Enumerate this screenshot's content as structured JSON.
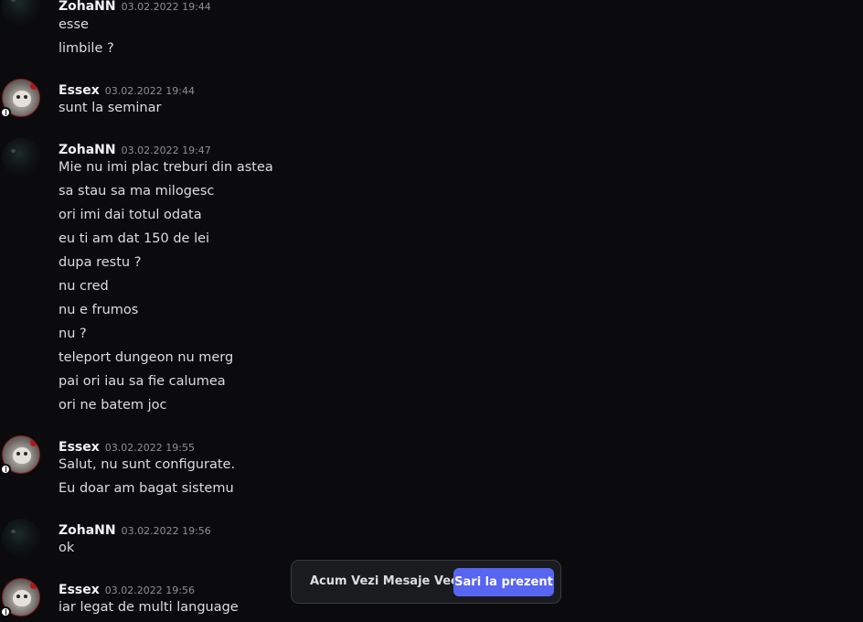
{
  "colors": {
    "background": "#0b0b0d",
    "username": "#f2f3f5",
    "timestamp": "#8c8f96",
    "message_text": "#dcdde1",
    "jump_button": "#5865f2",
    "jump_bar_background": "#1a1b1e"
  },
  "messages": [
    {
      "author": "ZohaNN",
      "timestamp": "03.02.2022 19:44",
      "avatar": "dark-avatar",
      "lines": [
        "esse",
        "limbile ?"
      ]
    },
    {
      "author": "Essex",
      "timestamp": "03.02.2022 19:44",
      "avatar": "grumpy-cat-avatar",
      "lines": [
        "sunt la seminar"
      ]
    },
    {
      "author": "ZohaNN",
      "timestamp": "03.02.2022 19:47",
      "avatar": "dark-avatar",
      "lines": [
        "Mie nu imi plac treburi din astea",
        "sa stau sa ma milogesc",
        "ori imi dai totul odata",
        "eu ti am dat 150 de lei",
        "dupa restu ?",
        "nu cred",
        "nu e frumos",
        "nu ?",
        "teleport dungeon nu merg",
        "pai ori iau sa fie calumea",
        "ori ne batem joc"
      ]
    },
    {
      "author": "Essex",
      "timestamp": "03.02.2022 19:55",
      "avatar": "grumpy-cat-avatar",
      "lines": [
        "Salut, nu sunt configurate.",
        "Eu doar am bagat sistemu"
      ]
    },
    {
      "author": "ZohaNN",
      "timestamp": "03.02.2022 19:56",
      "avatar": "dark-avatar",
      "lines": [
        "ok"
      ]
    },
    {
      "author": "Essex",
      "timestamp": "03.02.2022 19:56",
      "avatar": "grumpy-cat-avatar",
      "lines": [
        "iar legat de multi language"
      ]
    }
  ],
  "jump_bar": {
    "label": "Acum Vezi Mesaje Vechi",
    "button_label": "Sari la prezent"
  }
}
